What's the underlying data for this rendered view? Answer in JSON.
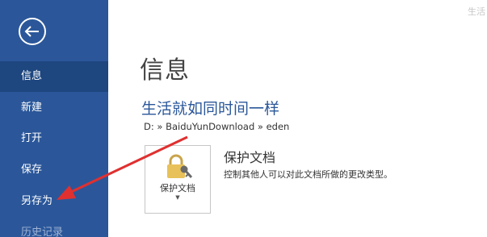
{
  "sidebar": {
    "items": [
      {
        "label": "信息"
      },
      {
        "label": "新建"
      },
      {
        "label": "打开"
      },
      {
        "label": "保存"
      },
      {
        "label": "另存为"
      },
      {
        "label": "历史记录"
      }
    ]
  },
  "header": {
    "topright_text": "生活"
  },
  "main": {
    "page_title": "信息",
    "doc_title": "生活就如同时间一样",
    "doc_path": "D: » BaiduYunDownload » eden",
    "protect": {
      "button_label": "保护文档",
      "title": "保护文档",
      "description": "控制其他人可以对此文档所做的更改类型。"
    }
  },
  "colors": {
    "sidebar_bg": "#2b579a",
    "sidebar_active": "#1e467f",
    "accent": "#2b579a",
    "annotation_arrow": "#e03030"
  },
  "icons": [
    "back-arrow-icon",
    "lock-key-icon",
    "chevron-down-icon"
  ]
}
